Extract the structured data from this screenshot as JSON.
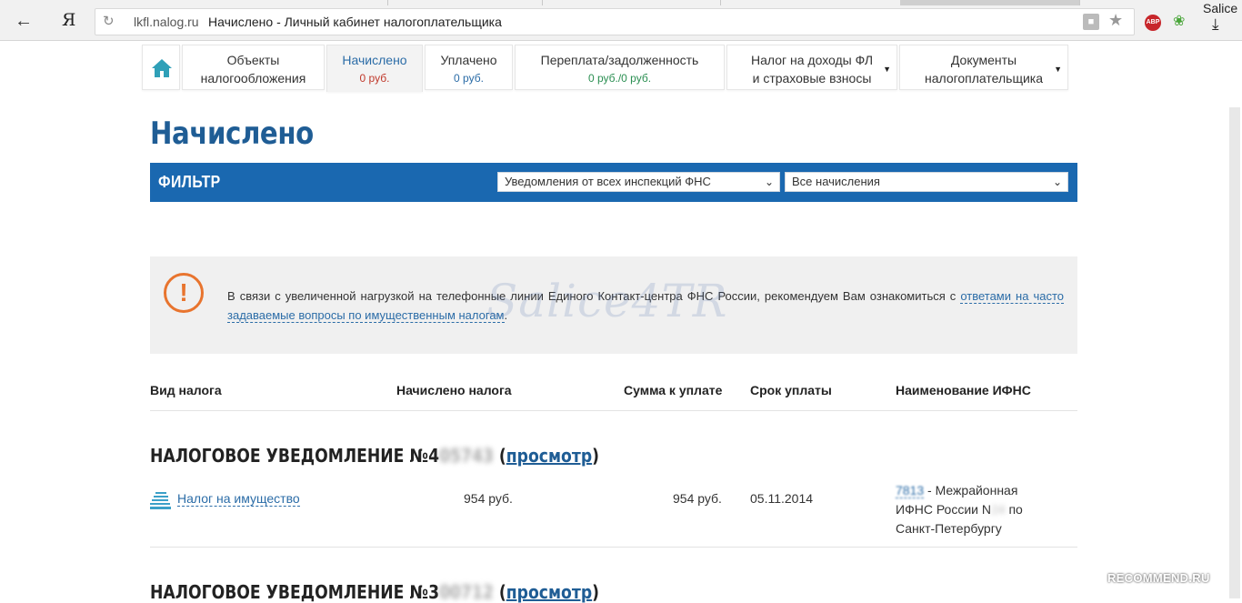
{
  "browser": {
    "domain": "lkfl.nalog.ru",
    "page_title": "Начислено - Личный кабинет налогоплательщика",
    "yandex_glyph": "Я",
    "user_label": "Salice",
    "abp_label": "ABP"
  },
  "nav": {
    "items": [
      {
        "l1": "Объекты",
        "l2": "налогообложения"
      },
      {
        "l1": "Начислено",
        "sum": "0 руб."
      },
      {
        "l1": "Уплачено",
        "sum": "0 руб."
      },
      {
        "l1": "Переплата/задолженность",
        "sum": "0 руб./0 руб."
      },
      {
        "l1": "Налог на доходы ФЛ",
        "l2": "и страховые взносы"
      },
      {
        "l1": "Документы",
        "l2": "налогоплательщика"
      }
    ]
  },
  "page": {
    "heading": "Начислено"
  },
  "filter": {
    "label": "ФИЛЬТР",
    "select1": "Уведомления от всех инспекций ФНС",
    "select2": "Все начисления"
  },
  "notice": {
    "text_before": "В связи с увеличенной нагрузкой на телефонные линии Единого Контакт-центра ФНС России, рекомендуем Вам ознакомиться с",
    "link": "ответами на часто задаваемые вопросы по имущественным налогам",
    "text_after": ".",
    "icon_glyph": "!"
  },
  "watermark": "Salice4TR",
  "table": {
    "headers": [
      "Вид налога",
      "Начислено налога",
      "Сумма к уплате",
      "Срок уплаты",
      "Наименование ИФНС"
    ]
  },
  "notifications": [
    {
      "title_prefix": "НАЛОГОВОЕ УВЕДОМЛЕНИЕ №4",
      "title_hidden": "05743",
      "view_link": "просмотр",
      "row": {
        "tax": "Налог на имущество",
        "accrued": "954 руб.",
        "to_pay": "954 руб.",
        "due": "05.11.2014",
        "ifns_code": "7813",
        "ifns_line1": " - Межрайонная",
        "ifns_line2": "ИФНС России N",
        "ifns_line2_hidden": "24",
        "ifns_line2_end": "по",
        "ifns_line3": "Санкт-Петербургу"
      }
    },
    {
      "title_prefix": "НАЛОГОВОЕ УВЕДОМЛЕНИЕ №3",
      "title_hidden": "00712",
      "view_link": "просмотр"
    }
  ],
  "recommend": "RECOMMEND.RU"
}
